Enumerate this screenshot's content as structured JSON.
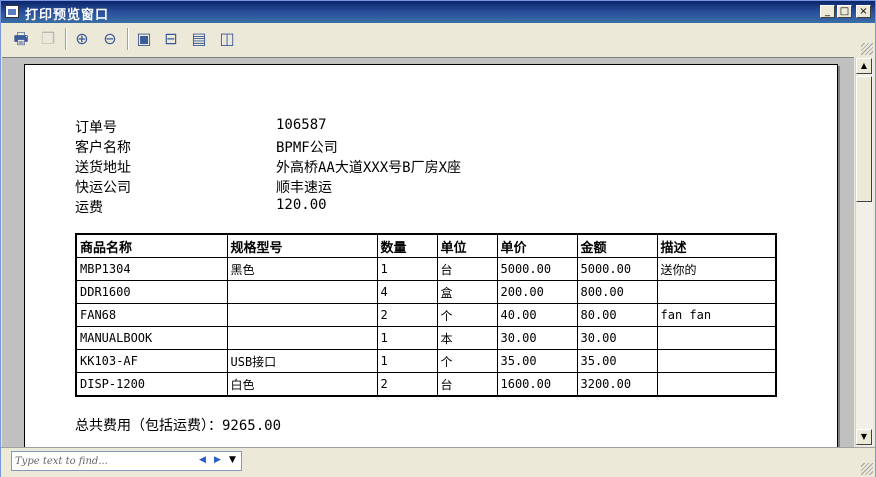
{
  "window": {
    "title": "打印预览窗口"
  },
  "title_buttons": {
    "minimize": "_",
    "maximize": "□",
    "close": "×"
  },
  "toolbar": {
    "tools": [
      {
        "name": "print-icon",
        "glyph": "🖶",
        "enabled": true
      },
      {
        "name": "copy-icon",
        "glyph": "❐",
        "enabled": false
      },
      {
        "name": "zoom-in-icon",
        "glyph": "⊕",
        "enabled": true
      },
      {
        "name": "zoom-out-icon",
        "glyph": "⊖",
        "enabled": true
      },
      {
        "name": "fit-page-icon",
        "glyph": "▣",
        "enabled": true
      },
      {
        "name": "fit-width-icon",
        "glyph": "⊟",
        "enabled": true
      },
      {
        "name": "single-page-icon",
        "glyph": "▤",
        "enabled": true
      },
      {
        "name": "two-pages-icon",
        "glyph": "◫",
        "enabled": true
      }
    ]
  },
  "order": {
    "fields": [
      {
        "label": "订单号",
        "value": "106587"
      },
      {
        "label": "客户名称",
        "value": "BPMF公司"
      },
      {
        "label": "送货地址",
        "value": "外高桥AA大道XXX号B厂房X座"
      },
      {
        "label": "快运公司",
        "value": "顺丰速运"
      },
      {
        "label": "运费",
        "value": "120.00"
      }
    ]
  },
  "items_table": {
    "headers": [
      "商品名称",
      "规格型号",
      "数量",
      "单位",
      "单价",
      "金额",
      "描述"
    ],
    "rows": [
      [
        "MBP1304",
        "黑色",
        "1",
        "台",
        "5000.00",
        "5000.00",
        "送你的"
      ],
      [
        "DDR1600",
        "",
        "4",
        "盒",
        "200.00",
        "800.00",
        ""
      ],
      [
        "FAN68",
        "",
        "2",
        "个",
        "40.00",
        "80.00",
        "fan fan"
      ],
      [
        "MANUALBOOK",
        "",
        "1",
        "本",
        "30.00",
        "30.00",
        ""
      ],
      [
        "KK103-AF",
        "USB接口",
        "1",
        "个",
        "35.00",
        "35.00",
        ""
      ],
      [
        "DISP-1200",
        "白色",
        "2",
        "台",
        "1600.00",
        "3200.00",
        ""
      ]
    ]
  },
  "total": {
    "text": "总共费用（包括运费）：9265.00"
  },
  "find": {
    "placeholder": "Type text to find...",
    "prev": "◀",
    "next": "▶",
    "dropdown": "▼"
  },
  "scrollbar": {
    "up": "▲",
    "down": "▼"
  },
  "colors": {
    "title_bar": "#0a246a",
    "window_bg": "#ece9d8",
    "page_bg": "#ffffff",
    "viewport_bg": "#c0c0c0"
  }
}
